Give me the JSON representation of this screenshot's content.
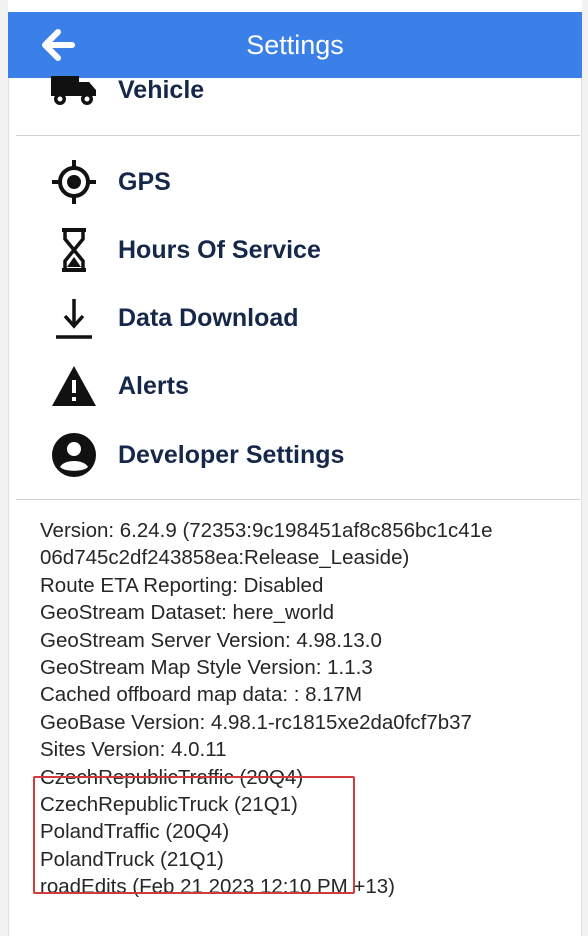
{
  "appbar": {
    "title": "Settings",
    "back_icon": "arrow-left-icon",
    "color": "#3b7fe8"
  },
  "menu": {
    "items": [
      {
        "label": "Vehicle",
        "icon": "truck-icon"
      },
      {
        "label": "GPS",
        "icon": "gps-crosshair-icon"
      },
      {
        "label": "Hours Of Service",
        "icon": "hourglass-icon"
      },
      {
        "label": "Data Download",
        "icon": "download-icon"
      },
      {
        "label": "Alerts",
        "icon": "warning-icon"
      },
      {
        "label": "Developer Settings",
        "icon": "account-circle-icon"
      }
    ]
  },
  "info": {
    "lines": [
      "Version: 6.24.9 (72353:9c198451af8c856bc1c41e",
      "06d745c2df243858ea:Release_Leaside)",
      "Route ETA Reporting: Disabled",
      "GeoStream Dataset: here_world",
      "GeoStream Server Version: 4.98.13.0",
      "GeoStream Map Style Version: 1.1.3",
      "Cached offboard map data: : 8.17M",
      "GeoBase Version:  4.98.1-rc1815xe2da0fcf7b37",
      "Sites Version:  4.0.11",
      "CzechRepublicTraffic (20Q4)",
      "CzechRepublicTruck (21Q1)",
      "PolandTraffic (20Q4)",
      "PolandTruck (21Q1)",
      "roadEdits (Feb 21 2023 12:10 PM +13)"
    ],
    "highlight_color": "#d23b3b"
  }
}
